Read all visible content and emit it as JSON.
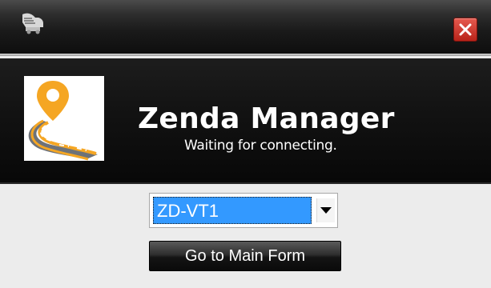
{
  "window": {
    "title_icon": "app-icon",
    "close_icon": "close-icon",
    "accent_close": "#d63a2f"
  },
  "banner": {
    "app_title": "Zenda Manager",
    "status": "Waiting for connecting.",
    "logo_icon": "map-pin-road-icon",
    "logo_colors": {
      "pin": "#f5a623",
      "road": "#6e7278",
      "background": "#ffffff"
    }
  },
  "device_select": {
    "selected": "ZD-VT1",
    "dropdown_icon": "chevron-down-icon",
    "highlight_color": "#3399ff"
  },
  "actions": {
    "main_form_label": "Go to Main Form"
  }
}
